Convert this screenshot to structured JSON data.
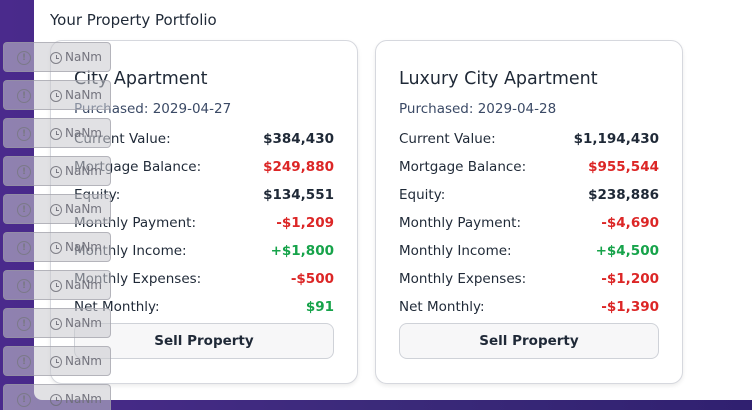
{
  "heading": "Your Property Portfolio",
  "properties": [
    {
      "title": "City Apartment",
      "purchased": "Purchased: 2029-04-27",
      "rows": [
        {
          "label": "Current Value:",
          "value": "$384,430",
          "tone": "neutral"
        },
        {
          "label": "Mortgage Balance:",
          "value": "$249,880",
          "tone": "neg"
        },
        {
          "label": "Equity:",
          "value": "$134,551",
          "tone": "neutral"
        },
        {
          "label": "Monthly Payment:",
          "value": "-$1,209",
          "tone": "neg"
        },
        {
          "label": "Monthly Income:",
          "value": "+$1,800",
          "tone": "pos"
        },
        {
          "label": "Monthly Expenses:",
          "value": "-$500",
          "tone": "neg"
        },
        {
          "label": "Net Monthly:",
          "value": "$91",
          "tone": "pos"
        }
      ],
      "sell_label": "Sell Property"
    },
    {
      "title": "Luxury City Apartment",
      "purchased": "Purchased: 2029-04-28",
      "rows": [
        {
          "label": "Current Value:",
          "value": "$1,194,430",
          "tone": "neutral"
        },
        {
          "label": "Mortgage Balance:",
          "value": "$955,544",
          "tone": "neg"
        },
        {
          "label": "Equity:",
          "value": "$238,886",
          "tone": "neutral"
        },
        {
          "label": "Monthly Payment:",
          "value": "-$4,690",
          "tone": "neg"
        },
        {
          "label": "Monthly Income:",
          "value": "+$4,500",
          "tone": "pos"
        },
        {
          "label": "Monthly Expenses:",
          "value": "-$1,200",
          "tone": "neg"
        },
        {
          "label": "Net Monthly:",
          "value": "-$1,390",
          "tone": "neg"
        }
      ],
      "sell_label": "Sell Property"
    }
  ],
  "overlay": {
    "excl_glyph": "!",
    "items": [
      "NaNm",
      "NaNm",
      "NaNm",
      "NaNm",
      "NaNm",
      "NaNm",
      "NaNm",
      "NaNm",
      "NaNm",
      "NaNm"
    ]
  },
  "colors": {
    "negative": "#dc2626",
    "positive": "#16a34a",
    "background": "#3b2a7a"
  }
}
